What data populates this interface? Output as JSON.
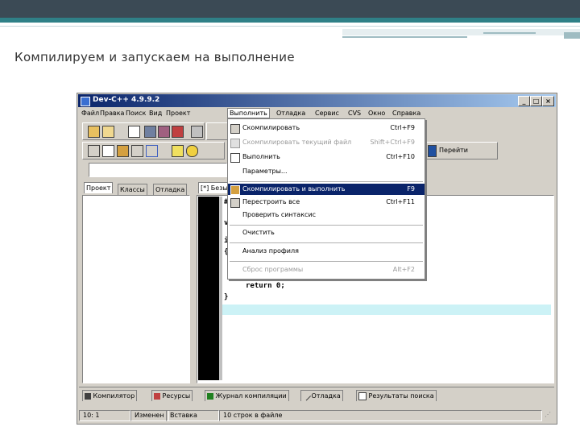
{
  "slide": {
    "title": "Компилируем и запускаем на выполнение",
    "colors": {
      "header_dark": "#3b4a55",
      "header_teal": "#2f8087"
    }
  },
  "window": {
    "title": "Dev-C++ 4.9.9.2",
    "controls": {
      "minimize": "_",
      "maximize": "□",
      "close": "×"
    },
    "menus": [
      "Файл",
      "Правка",
      "Поиск",
      "Вид",
      "Проект",
      "Выполнить",
      "Отладка",
      "Сервис",
      "CVS",
      "Окно",
      "Справка"
    ],
    "active_menu_index": 5,
    "toolbar_goto_label": "Перейти",
    "left_tabs": [
      "Проект",
      "Классы",
      "Отладка"
    ],
    "editor_tab": "[*] Безы",
    "code_lines": [
      "#",
      "v",
      "i",
      "{",
      "return 0;",
      "}"
    ],
    "run_menu": [
      {
        "label": "Скомпилировать",
        "shortcut": "Ctrl+F9",
        "enabled": true,
        "icon": "compile-icon"
      },
      {
        "label": "Скомпилировать текущий файл",
        "shortcut": "Shift+Ctrl+F9",
        "enabled": false,
        "icon": "compile-file-icon"
      },
      {
        "label": "Выполнить",
        "shortcut": "Ctrl+F10",
        "enabled": true,
        "icon": "run-icon"
      },
      {
        "label": "Параметры...",
        "shortcut": "",
        "enabled": true,
        "icon": ""
      },
      {
        "label": "Скомпилировать и выполнить",
        "shortcut": "F9",
        "enabled": true,
        "highlighted": true,
        "icon": "compile-run-icon"
      },
      {
        "label": "Перестроить все",
        "shortcut": "Ctrl+F11",
        "enabled": true,
        "icon": "rebuild-icon"
      },
      {
        "label": "Проверить синтаксис",
        "shortcut": "",
        "enabled": true,
        "icon": ""
      },
      {
        "label": "Очистить",
        "shortcut": "",
        "enabled": true,
        "icon": ""
      },
      {
        "label": "Анализ профиля",
        "shortcut": "",
        "enabled": true,
        "icon": ""
      },
      {
        "label": "Сброс программы",
        "shortcut": "Alt+F2",
        "enabled": false,
        "icon": ""
      }
    ],
    "bottom_tabs": [
      "Компилятор",
      "Ресурсы",
      "Журнал компиляции",
      "Отладка",
      "Результаты поиска"
    ],
    "status": {
      "position": "10: 1",
      "modified": "Изменен",
      "mode": "Вставка",
      "lines": "10 строк в файле"
    }
  }
}
